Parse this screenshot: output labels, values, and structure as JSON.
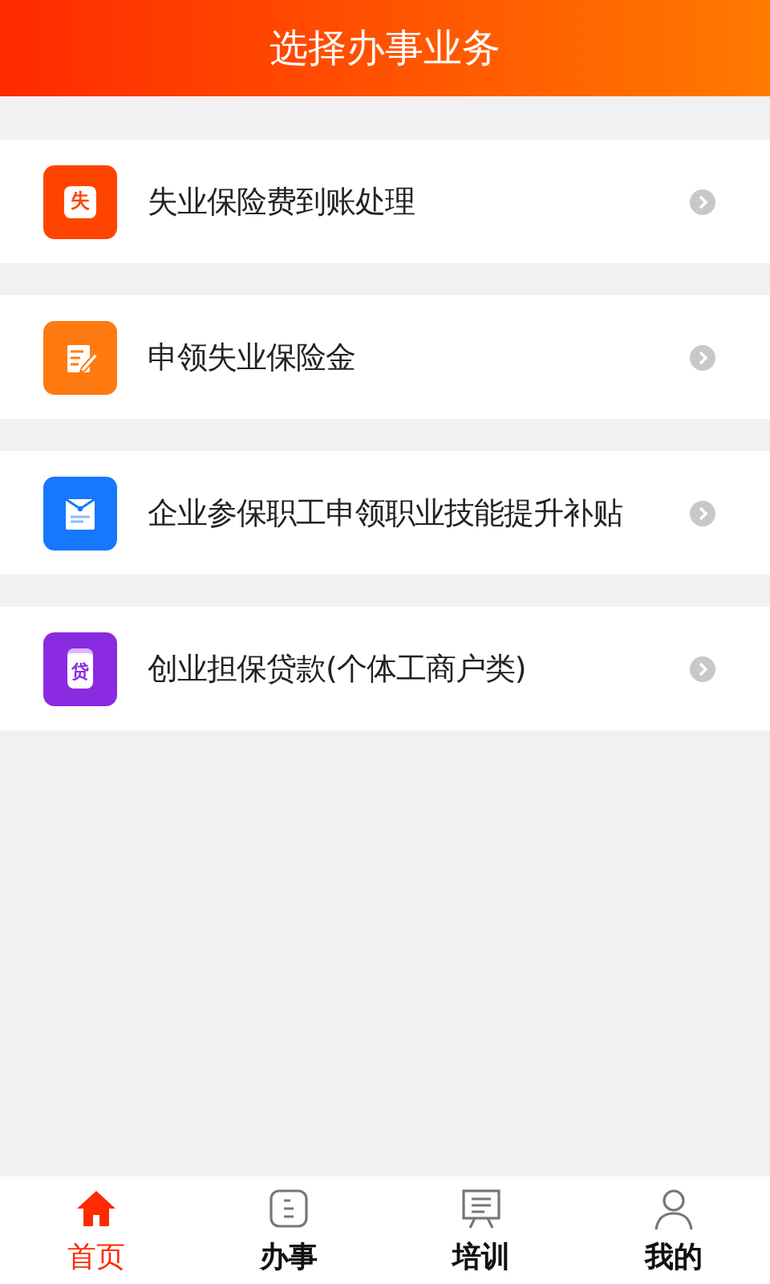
{
  "header": {
    "title": "选择办事业务"
  },
  "services": [
    {
      "label": "失业保险费到账处理",
      "icon": {
        "kind": "glyph",
        "glyph": "失"
      },
      "color": "#ff4400"
    },
    {
      "label": "申领失业保险金",
      "icon": {
        "kind": "pen"
      },
      "color": "#ff7a10"
    },
    {
      "label": "企业参保职工申领职业技能提升补贴",
      "icon": {
        "kind": "envelope"
      },
      "color": "#1677ff"
    },
    {
      "label": "创业担保贷款(个体工商户类)",
      "icon": {
        "kind": "clipboard",
        "glyph": "贷"
      },
      "color": "#8a2be2"
    }
  ],
  "tabs": [
    {
      "label": "首页",
      "kind": "home",
      "selected": true
    },
    {
      "label": "办事",
      "kind": "doc",
      "selected": false
    },
    {
      "label": "培训",
      "kind": "board",
      "selected": false
    },
    {
      "label": "我的",
      "kind": "person",
      "selected": false
    }
  ]
}
